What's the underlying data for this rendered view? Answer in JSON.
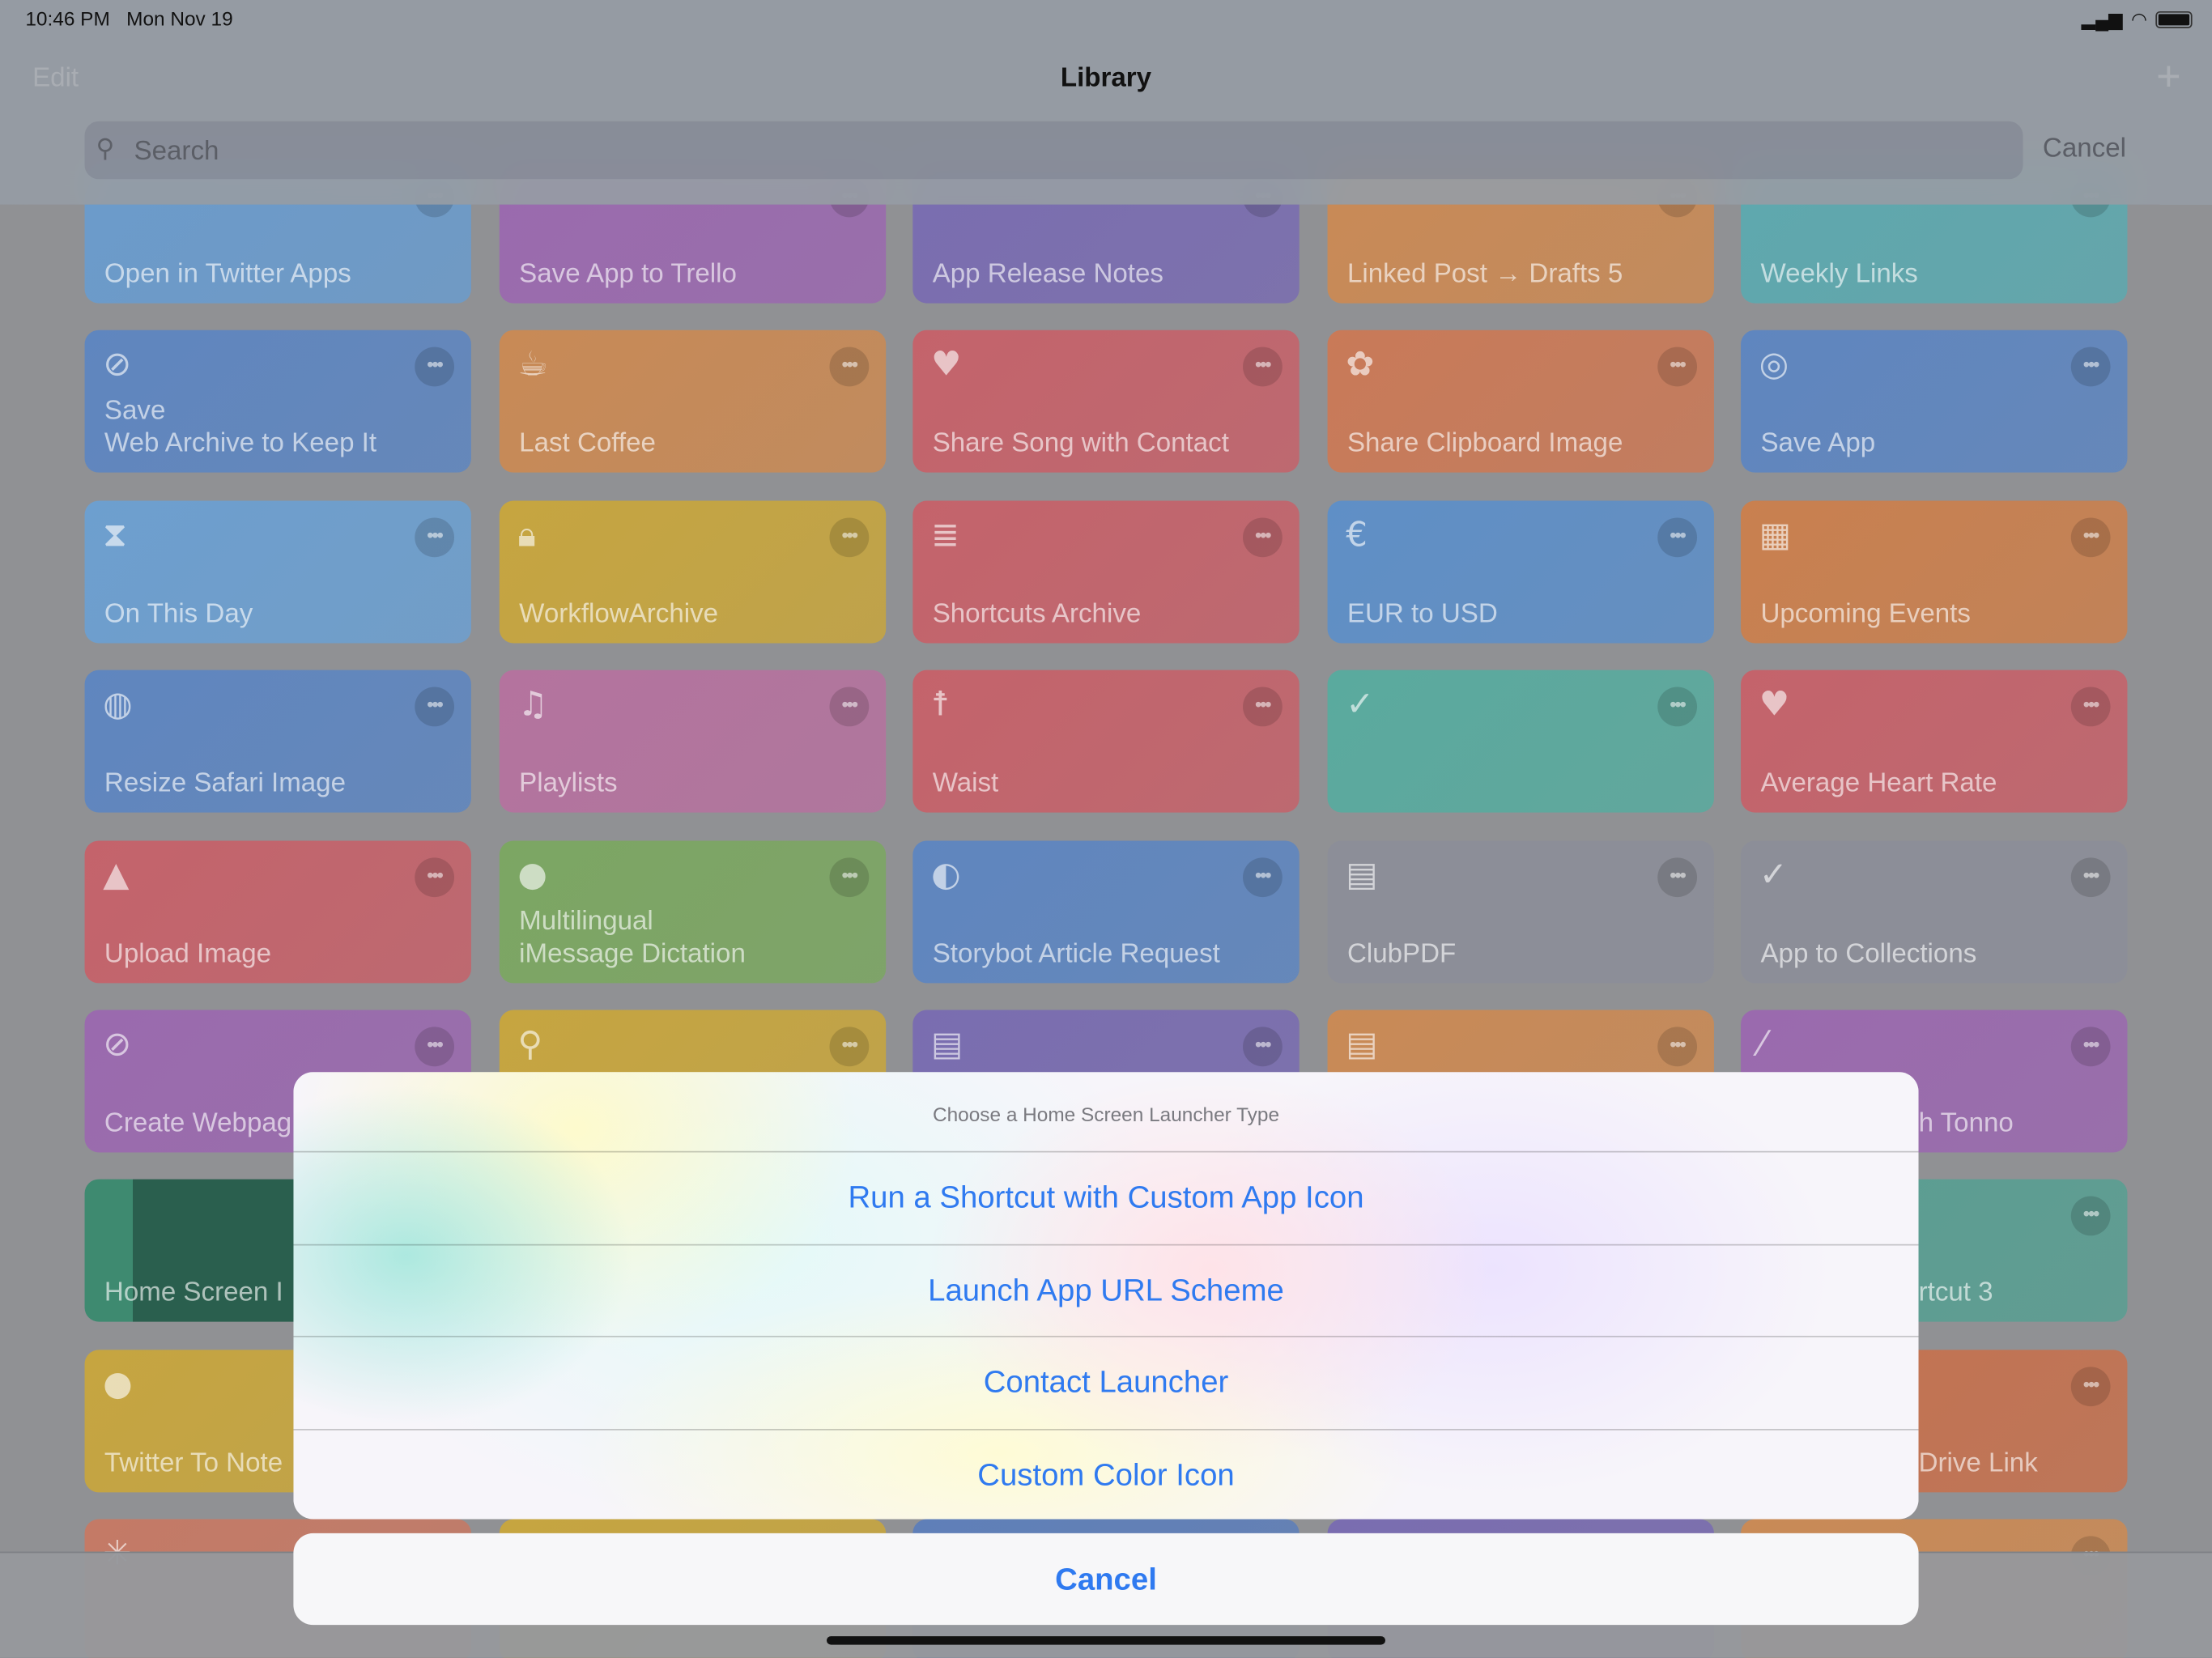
{
  "status_bar": {
    "time": "10:46 PM",
    "date": "Mon Nov 19"
  },
  "nav": {
    "edit_label": "Edit",
    "title": "Library",
    "add_icon": "plus-icon"
  },
  "search": {
    "placeholder": "Search",
    "value": "",
    "cancel_label": "Cancel"
  },
  "colors": {
    "accent": "#2f7af0"
  },
  "tiles": [
    [
      {
        "label": "Open in Twitter Apps",
        "color": "#6b9bcb",
        "icon": ""
      },
      {
        "label": "Save App to Trello",
        "color": "#9a6aae",
        "icon": ""
      },
      {
        "label": "App Release Notes",
        "color": "#7a6db0",
        "icon": ""
      },
      {
        "label": "Linked Post → Drafts 5",
        "color": "#c98a56",
        "icon": ""
      },
      {
        "label": "Weekly Links",
        "color": "#5ea8ae",
        "icon": ""
      }
    ],
    [
      {
        "label": "Save\nWeb Archive to Keep It",
        "color": "#5f86bf",
        "icon": "compass-icon"
      },
      {
        "label": "Last Coffee",
        "color": "#c88a56",
        "icon": "coffee-cup-icon"
      },
      {
        "label": "Share Song with Contact",
        "color": "#c4636b",
        "icon": "heart-icon"
      },
      {
        "label": "Share Clipboard Image",
        "color": "#c97a58",
        "icon": "gear-flower-icon"
      },
      {
        "label": "Save App",
        "color": "#5f86bf",
        "icon": "target-icon"
      }
    ],
    [
      {
        "label": "On This Day",
        "color": "#6d9fcf",
        "icon": "hourglass-icon"
      },
      {
        "label": "WorkflowArchive",
        "color": "#c6a540",
        "icon": "lock-icon"
      },
      {
        "label": "Shortcuts Archive",
        "color": "#c4636b",
        "icon": "database-icon"
      },
      {
        "label": "EUR to USD",
        "color": "#5f8fc6",
        "icon": "euro-icon"
      },
      {
        "label": "Upcoming Events",
        "color": "#c9804f",
        "icon": "calendar-icon"
      }
    ],
    [
      {
        "label": "Resize Safari Image",
        "color": "#5f86bf",
        "icon": "globe-icon"
      },
      {
        "label": "Playlists",
        "color": "#b4739e",
        "icon": "music-note-icon"
      },
      {
        "label": "Waist",
        "color": "#c4636b",
        "icon": "person-icon"
      },
      {
        "label": "",
        "color": "#5aaa9e",
        "icon": "checkmark-icon"
      },
      {
        "label": "Average Heart Rate",
        "color": "#c4636b",
        "icon": "heart-icon"
      }
    ],
    [
      {
        "label": "Upload Image",
        "color": "#c4636b",
        "icon": "image-icon"
      },
      {
        "label": "Multilingual\niMessage Dictation",
        "color": "#7ca663",
        "icon": "speech-bubbles-icon"
      },
      {
        "label": "Storybot Article Request",
        "color": "#5f86bf",
        "icon": "alien-icon"
      },
      {
        "label": "ClubPDF",
        "color": "#8c8e98",
        "icon": "document-icon"
      },
      {
        "label": "App to Collections",
        "color": "#8c8e98",
        "icon": "checkmark-icon"
      }
    ],
    [
      {
        "label": "Create Webpag",
        "color": "#9a6aae",
        "icon": "compass-icon"
      },
      {
        "label": "",
        "color": "#c6a540",
        "icon": "magnifier-icon"
      },
      {
        "label": "",
        "color": "#7a6db0",
        "icon": "list-icon"
      },
      {
        "label": "",
        "color": "#c98a56",
        "icon": "list-icon"
      },
      {
        "label": "h Tonno",
        "color": "#9a6aae",
        "icon": "magic-wand-icon"
      }
    ],
    [
      {
        "label": "Home Screen I",
        "color": "#2f6b58",
        "icon": ""
      },
      {
        "label": "",
        "color": "#c6a540",
        "icon": ""
      },
      {
        "label": "",
        "color": "#7a6db0",
        "icon": ""
      },
      {
        "label": "",
        "color": "#c98a56",
        "icon": ""
      },
      {
        "label": "rtcut 3",
        "color": "#5a9e92",
        "icon": ""
      }
    ],
    [
      {
        "label": "Twitter To Note",
        "color": "#c6a540",
        "icon": "speech-bubble-icon"
      },
      {
        "label": "",
        "color": "#c6a540",
        "icon": ""
      },
      {
        "label": "",
        "color": "#5f86bf",
        "icon": ""
      },
      {
        "label": "",
        "color": "#7a6db0",
        "icon": ""
      },
      {
        "label": "Drive Link",
        "color": "#c47250",
        "icon": ""
      }
    ],
    [
      {
        "label": "",
        "color": "#c47a66",
        "icon": "sparkle-icon"
      },
      {
        "label": "",
        "color": "#c6a540",
        "icon": ""
      },
      {
        "label": "",
        "color": "#5f7fb8",
        "icon": ""
      },
      {
        "label": "",
        "color": "#7a6db0",
        "icon": ""
      },
      {
        "label": "",
        "color": "#c98a56",
        "icon": ""
      }
    ]
  ],
  "sheet": {
    "title": "Choose a Home Screen Launcher Type",
    "options": [
      "Run a Shortcut with Custom App Icon",
      "Launch App URL Scheme",
      "Contact Launcher",
      "Custom Color Icon"
    ],
    "cancel_label": "Cancel"
  }
}
